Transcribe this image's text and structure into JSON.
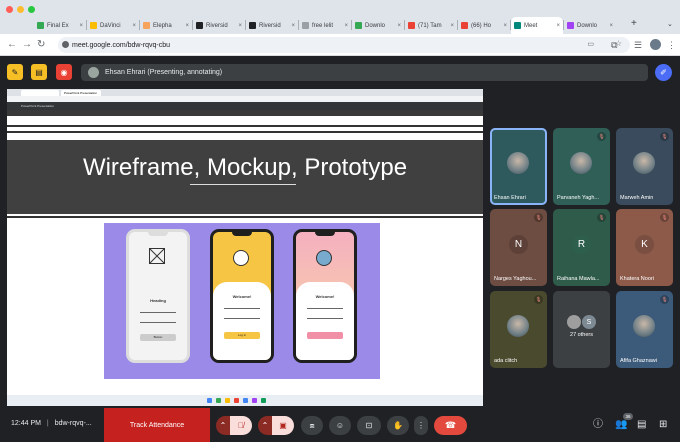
{
  "browser": {
    "tabs": [
      {
        "label": "Final Ex",
        "color": "#34a853"
      },
      {
        "label": "DaVinci",
        "color": "#fbbc04"
      },
      {
        "label": "Elepha",
        "color": "#f6a35b"
      },
      {
        "label": "Riversid",
        "color": "#202124"
      },
      {
        "label": "Riversid",
        "color": "#202124"
      },
      {
        "label": "free lelit",
        "color": "#9aa0a6"
      },
      {
        "label": "Downlo",
        "color": "#34a853"
      },
      {
        "label": "(71) Tam",
        "color": "#ea4335"
      },
      {
        "label": "(66) Ho",
        "color": "#ea4335"
      },
      {
        "label": "Meet",
        "color": "#00897b"
      },
      {
        "label": "Downlo",
        "color": "#a142f4"
      }
    ],
    "active_tab_index": 9,
    "url": "meet.google.com/bdw-rqvq-cbu"
  },
  "meet": {
    "presenter_label": "Ehsan Ehrari (Presenting, annotating)",
    "shared_screen": {
      "tab_text": "PowerPoint Presentation",
      "slide_title": "Wireframe, Mockup, Prototype",
      "phone1": {
        "heading": "Heading",
        "button": "Button"
      },
      "phone2": {
        "heading": "Welcome!",
        "button": "Log in"
      },
      "phone3": {
        "heading": "Welcome!"
      }
    },
    "participants": [
      {
        "name": "Ehsan Ehrari",
        "kind": "pic",
        "bg": "#2e5a5e",
        "mic": "",
        "highlight": true
      },
      {
        "name": "Parvaneh Yagh...",
        "kind": "pic",
        "bg": "#2f5f57",
        "mic": "muted",
        "highlight": false
      },
      {
        "name": "Marweh Amin",
        "kind": "pic",
        "bg": "#394b5c",
        "mic": "muted",
        "highlight": false
      },
      {
        "name": "Narges Yaghou...",
        "kind": "letter",
        "letter": "N",
        "bg": "#6d4c41",
        "avatar": "#5d4037",
        "mic": "muted",
        "highlight": false
      },
      {
        "name": "Raihana Mawla...",
        "kind": "letter",
        "letter": "R",
        "bg": "#2f5b4a",
        "avatar": "#2e5e4c",
        "mic": "muted",
        "highlight": false
      },
      {
        "name": "Khatera Noori",
        "kind": "letter",
        "letter": "K",
        "bg": "#8d5a4a",
        "avatar": "#7a4e40",
        "mic": "muted",
        "highlight": false
      },
      {
        "name": "ada clitch",
        "kind": "pic",
        "bg": "#4a4a2e",
        "mic": "muted",
        "highlight": false
      },
      {
        "name": "27 others",
        "kind": "others",
        "letter": "S",
        "bg": "#3c4043",
        "mic": "",
        "highlight": false
      },
      {
        "name": "Afifa Ghaznawi",
        "kind": "pic",
        "bg": "#3c5a7a",
        "mic": "muted",
        "highlight": false
      }
    ],
    "bottom": {
      "time": "12:44 PM",
      "meeting_code": "bdw-rqvq-...",
      "track_attendance": "Track Attendance",
      "people_count": "36"
    }
  }
}
